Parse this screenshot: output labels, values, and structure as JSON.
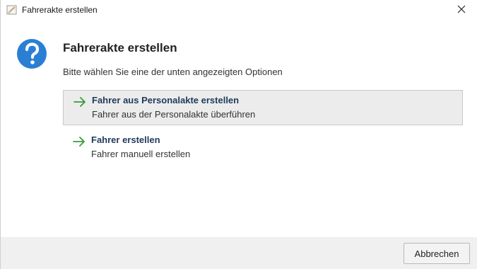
{
  "window": {
    "title": "Fahrerakte erstellen",
    "close_glyph": "×"
  },
  "dialog": {
    "icon": "question-icon",
    "heading": "Fahrerakte erstellen",
    "subtitle": "Bitte wählen Sie eine der unten angezeigten Optionen",
    "options": [
      {
        "icon": "arrow-right-icon",
        "title": "Fahrer aus Personalakte erstellen",
        "description": "Fahrer aus der Personalakte überführen",
        "selected": true
      },
      {
        "icon": "arrow-right-icon",
        "title": "Fahrer erstellen",
        "description": "Fahrer manuell erstellen",
        "selected": false
      }
    ]
  },
  "footer": {
    "cancel_label": "Abbrechen"
  },
  "colors": {
    "accent_blue": "#2a7fd4",
    "arrow_green": "#3c9a3c",
    "option_title": "#1f3a5a"
  }
}
